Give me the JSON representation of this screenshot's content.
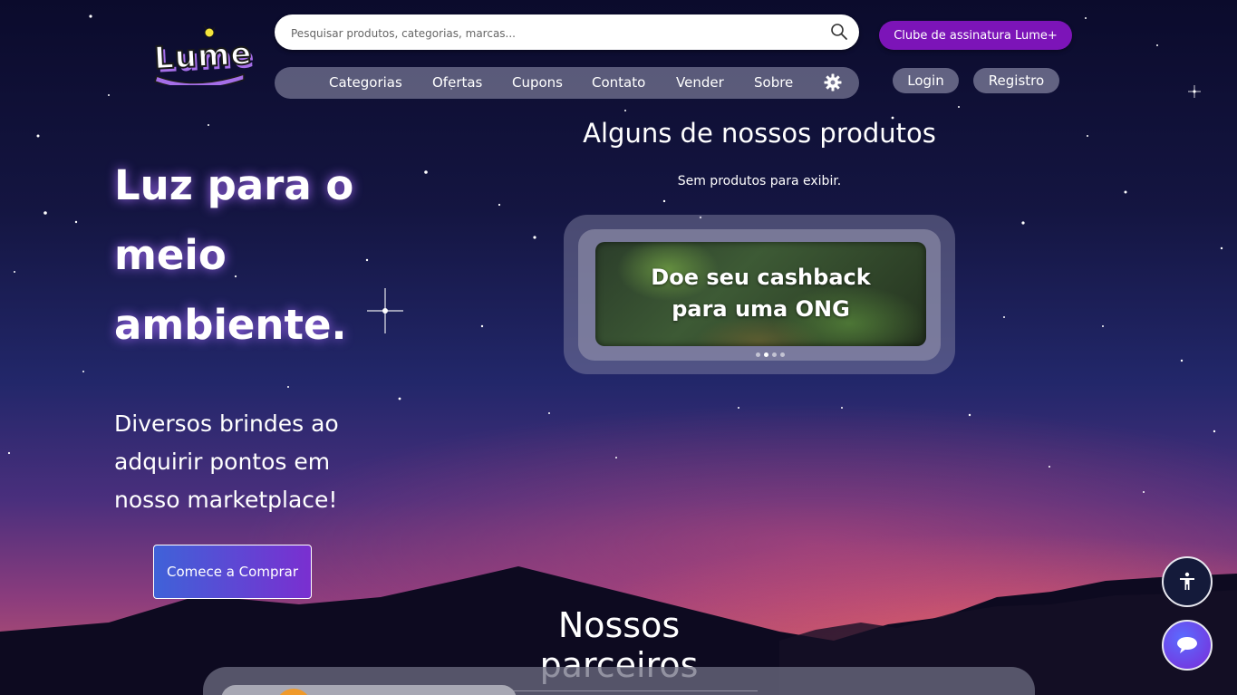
{
  "header": {
    "logo_text": "Lume",
    "search_placeholder": "Pesquisar produtos, categorias, marcas...",
    "club_label": "Clube de assinatura Lume+",
    "nav_items": [
      "Categorias",
      "Ofertas",
      "Cupons",
      "Contato",
      "Vender",
      "Sobre"
    ],
    "login_label": "Login",
    "register_label": "Registro"
  },
  "hero": {
    "title_lines": [
      "Luz para o",
      "meio",
      "ambiente."
    ],
    "subtitle_lines": [
      "Diversos brindes ao",
      "adquirir pontos em",
      "nosso marketplace!"
    ],
    "cta_label": "Comece a Comprar"
  },
  "products": {
    "title": "Alguns de nossos produtos",
    "empty_message": "Sem produtos para exibir.",
    "slide_text_lines": [
      "Doe seu cashback",
      "para uma ONG"
    ],
    "slide_count": 4,
    "active_slide": 2
  },
  "partners": {
    "title": "Nossos parceiros"
  },
  "icons": {
    "search": "search-icon",
    "settings": "gear-icon",
    "accessibility": "accessibility-icon",
    "chat": "chat-icon"
  },
  "colors": {
    "club_button": "#7c14b8",
    "cta_start": "#3f62d8",
    "cta_end": "#7a2fd0"
  }
}
